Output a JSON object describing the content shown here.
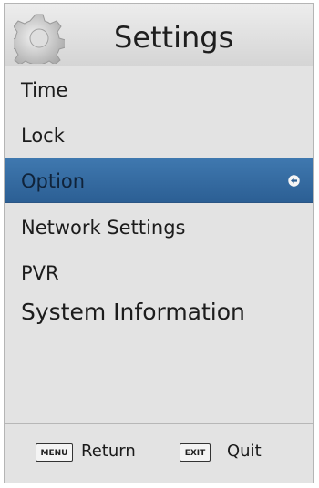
{
  "header": {
    "title": "Settings",
    "icon": "gear-icon"
  },
  "menu": {
    "items": [
      {
        "label": "Time"
      },
      {
        "label": "Lock"
      },
      {
        "label": "Option",
        "selected": true
      },
      {
        "label": "Network Settings"
      },
      {
        "label": "PVR"
      },
      {
        "label": "System Information"
      }
    ],
    "selected_indicator_icon": "enter-arrow-icon"
  },
  "footer": {
    "menu_key": "MENU",
    "menu_action": "Return",
    "exit_key": "EXIT",
    "exit_action": "Quit"
  },
  "colors": {
    "panel_background": "#e3e3e3",
    "selection": "#336a9f",
    "text": "#1c1c1c"
  }
}
